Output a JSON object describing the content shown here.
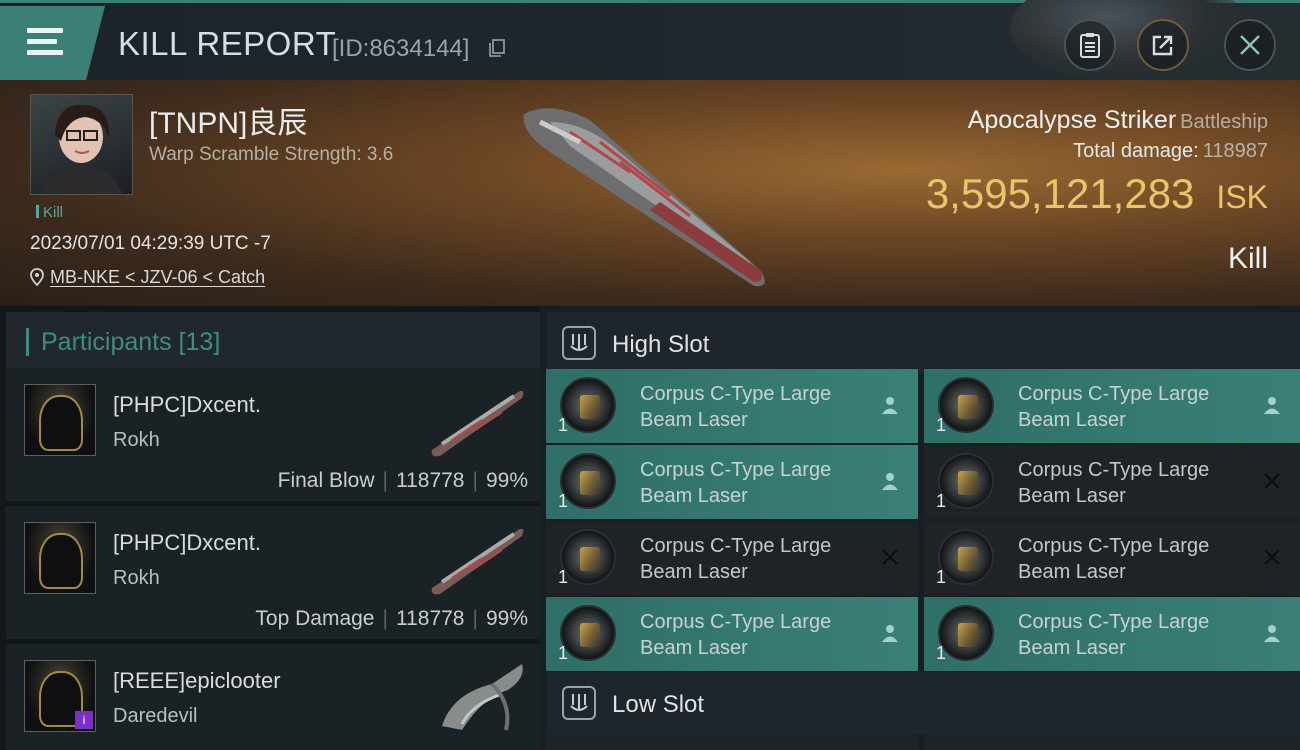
{
  "header": {
    "title": "KILL REPORT",
    "report_id": "[ID:8634144]"
  },
  "victim": {
    "pilot_name": "[TNPN]良辰",
    "warp_scramble": "Warp Scramble Strength: 3.6",
    "tag": "Kill",
    "datetime": "2023/07/01 04:29:39 UTC -7",
    "location": "MB-NKE < JZV-06 < Catch",
    "ship_name": "Apocalypse Striker",
    "ship_class": "Battleship",
    "total_damage_label": "Total damage:",
    "total_damage": "118987",
    "isk_value": "3,595,121,283",
    "isk_unit": "ISK",
    "result": "Kill"
  },
  "participants": {
    "title": "Participants [13]",
    "rows": [
      {
        "name": "[PHPC]Dxcent.",
        "ship": "Rokh",
        "role": "Final Blow",
        "damage": "118778",
        "percent": "99%"
      },
      {
        "name": "[PHPC]Dxcent.",
        "ship": "Rokh",
        "role": "Top Damage",
        "damage": "118778",
        "percent": "99%"
      },
      {
        "name": "[REEE]epiclooter",
        "ship": "Daredevil",
        "badge": "i"
      }
    ]
  },
  "fitting": {
    "high_slot_title": "High Slot",
    "low_slot_title": "Low Slot",
    "modules": [
      {
        "line1": "Corpus C-Type Large",
        "line2": "Beam Laser",
        "qty": "1",
        "state": "dropped"
      },
      {
        "line1": "Corpus C-Type Large",
        "line2": "Beam Laser",
        "qty": "1",
        "state": "dropped"
      },
      {
        "line1": "Corpus C-Type Large",
        "line2": "Beam Laser",
        "qty": "1",
        "state": "dropped"
      },
      {
        "line1": "Corpus C-Type Large",
        "line2": "Beam Laser",
        "qty": "1",
        "state": "destroyed"
      },
      {
        "line1": "Corpus C-Type Large",
        "line2": "Beam Laser",
        "qty": "1",
        "state": "destroyed"
      },
      {
        "line1": "Corpus C-Type Large",
        "line2": "Beam Laser",
        "qty": "1",
        "state": "destroyed"
      },
      {
        "line1": "Corpus C-Type Large",
        "line2": "Beam Laser",
        "qty": "1",
        "state": "dropped"
      },
      {
        "line1": "Corpus C-Type Large",
        "line2": "Beam Laser",
        "qty": "1",
        "state": "dropped"
      }
    ]
  },
  "colors": {
    "accent_teal": "#3b7f77",
    "isk_gold": "#e8c46a"
  }
}
